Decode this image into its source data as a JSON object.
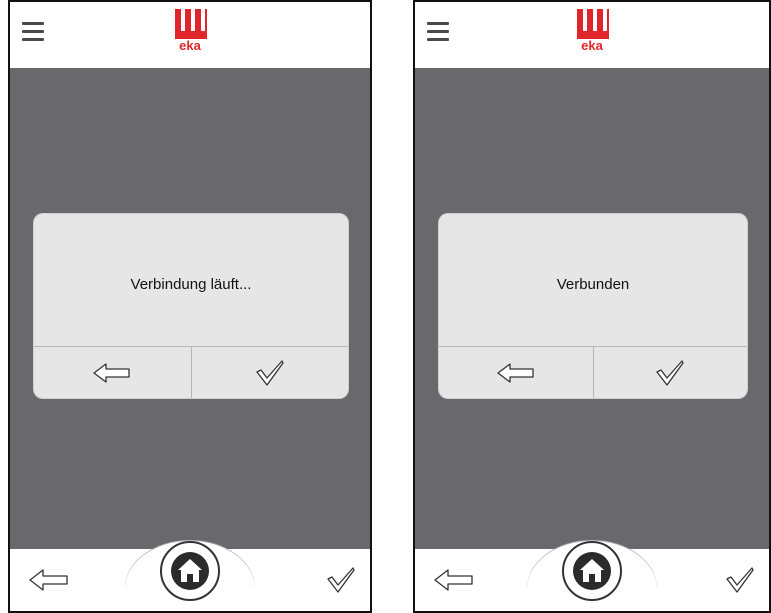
{
  "screens": [
    {
      "id": "left",
      "header": {
        "brand": "eka",
        "icons": [
          "menu-icon",
          "eka-logo"
        ]
      },
      "dialog": {
        "message": "Verbindung läuft...",
        "buttons": [
          {
            "icon": "arrow-left-icon"
          },
          {
            "icon": "checkmark-icon"
          }
        ]
      },
      "footer": {
        "icons": [
          "arrow-left-icon",
          "home-icon",
          "checkmark-icon"
        ]
      }
    },
    {
      "id": "right",
      "header": {
        "brand": "eka",
        "icons": [
          "menu-icon",
          "eka-logo"
        ]
      },
      "dialog": {
        "message": "Verbunden",
        "buttons": [
          {
            "icon": "arrow-left-icon"
          },
          {
            "icon": "checkmark-icon"
          }
        ]
      },
      "footer": {
        "icons": [
          "arrow-left-icon",
          "home-icon",
          "checkmark-icon"
        ]
      }
    }
  ],
  "colors": {
    "brand_red": "#e0262b",
    "background_gray": "#69686d",
    "dialog_bg": "#e6e6e6"
  }
}
